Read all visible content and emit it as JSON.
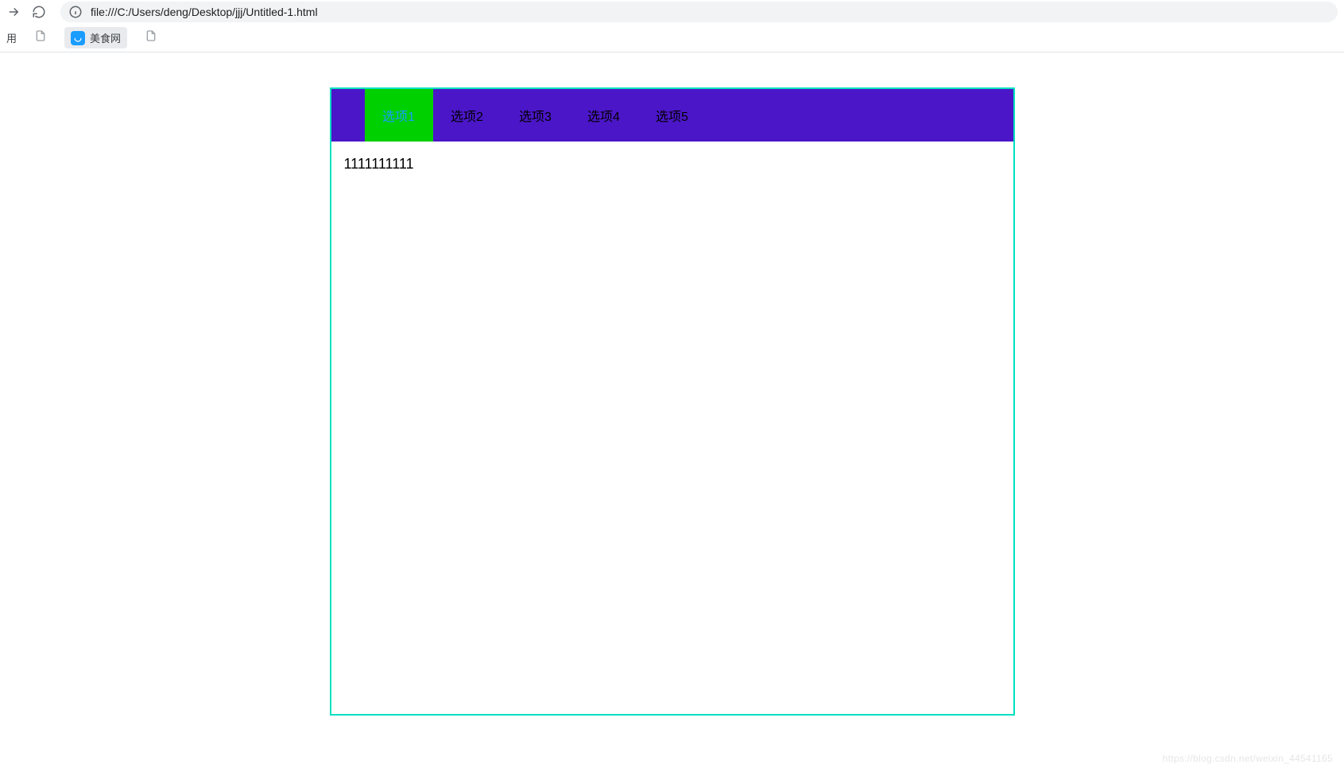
{
  "browser": {
    "url": "file:///C:/Users/deng/Desktop/jjj/Untitled-1.html",
    "bookmarks": {
      "apps_label": "用",
      "item_food": "美食网"
    }
  },
  "page": {
    "tabs": [
      {
        "label": "选项1",
        "active": true
      },
      {
        "label": "选项2",
        "active": false
      },
      {
        "label": "选项3",
        "active": false
      },
      {
        "label": "选项4",
        "active": false
      },
      {
        "label": "选项5",
        "active": false
      }
    ],
    "content_text": "1111111111"
  },
  "watermark": "https://blog.csdn.net/weixin_44541165"
}
